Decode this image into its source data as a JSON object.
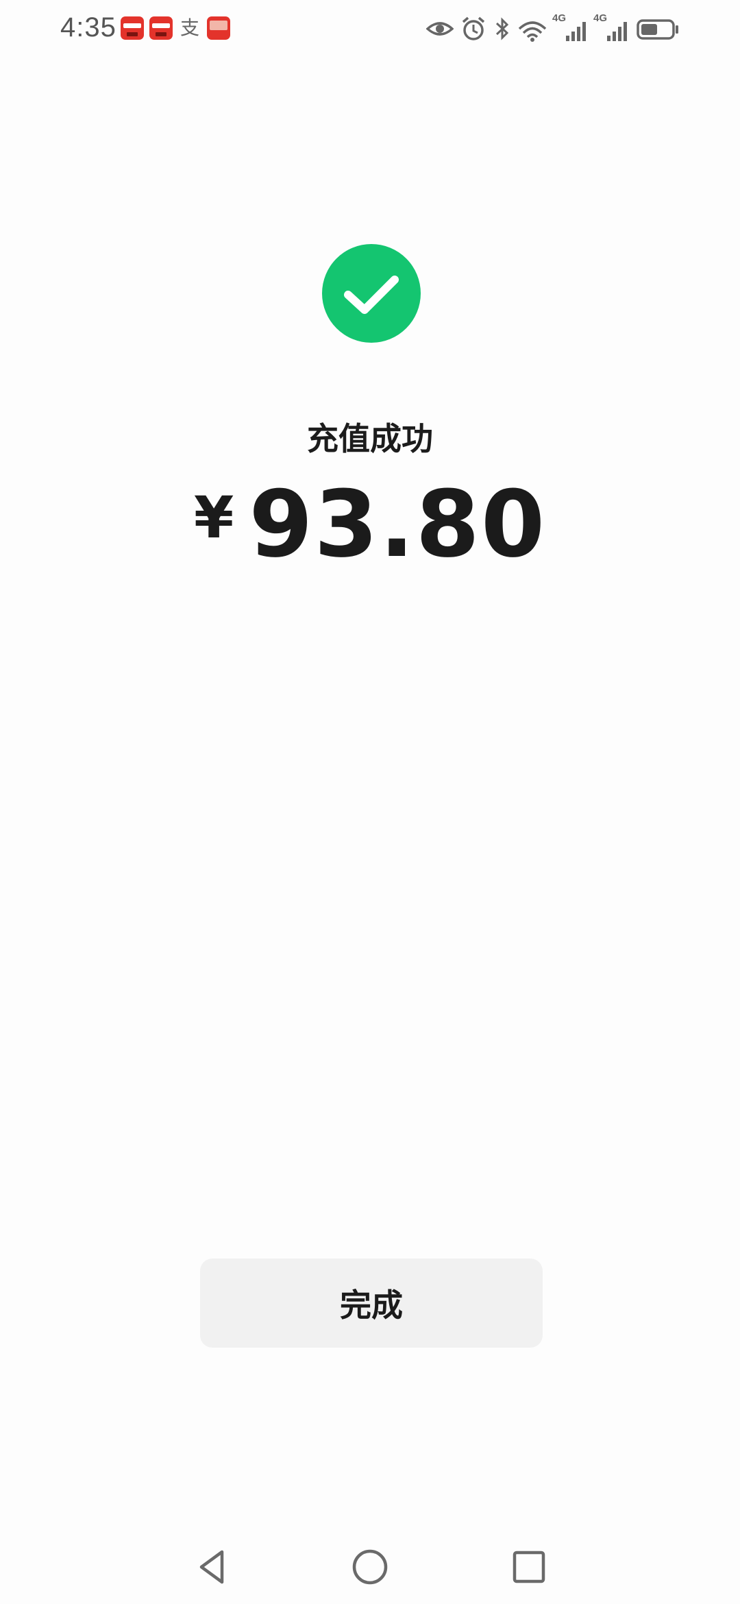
{
  "status_bar": {
    "time": "4:35",
    "notification_icons": [
      "newspaper-app-icon",
      "newspaper-app-icon",
      "alipay-icon",
      "taobao-icon"
    ],
    "alipay_glyph": "支",
    "system_icons": [
      "eye-icon",
      "alarm-icon",
      "bluetooth-icon",
      "wifi-icon",
      "signal-icon",
      "signal-icon",
      "battery-icon"
    ],
    "signal_label_1": "4G",
    "signal_label_2": "4G",
    "battery_level": 0.55
  },
  "result": {
    "status_icon": "checkmark-icon",
    "title": "充值成功",
    "currency_symbol": "¥",
    "amount": "93.80"
  },
  "actions": {
    "done_label": "完成"
  },
  "nav_bar": {
    "buttons": [
      "back-icon",
      "home-icon",
      "recents-icon"
    ]
  },
  "colors": {
    "success_green": "#14c570",
    "button_bg": "#f1f1f1",
    "text": "#1b1b1b",
    "background": "#fdfdfd"
  }
}
